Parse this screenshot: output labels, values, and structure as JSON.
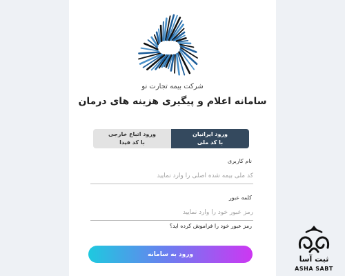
{
  "company_name": "شرکت بیمه تجارت نو",
  "system_title": "سامانه اعلام و پیگیری هزینه های درمان",
  "tabs": [
    {
      "line1": "ورود ایرانیان",
      "line2": "با کد ملی",
      "active": true
    },
    {
      "line1": "ورود اتباع خارجی",
      "line2": "با کد فیدا",
      "active": false
    }
  ],
  "username": {
    "label": "نام کاربری",
    "placeholder": "کد ملی بیمه شده اصلی را وارد نمایید",
    "value": ""
  },
  "password": {
    "label": "کلمه عبور",
    "placeholder": "رمز عبور خود را وارد نمایید",
    "value": ""
  },
  "forgot_password": "رمز عبور خود را فراموش کرده اید؟",
  "submit_label": "ورود به سامانه",
  "watermark": {
    "persian": "ثبت آسا",
    "latin": "ASHA SABT"
  },
  "colors": {
    "active_tab": "#34495e",
    "inactive_tab": "#e3e3e3",
    "button_gradient": [
      "#1ec9df",
      "#cd37f2"
    ]
  },
  "icons": [
    "company-logo",
    "watermark-logo"
  ]
}
